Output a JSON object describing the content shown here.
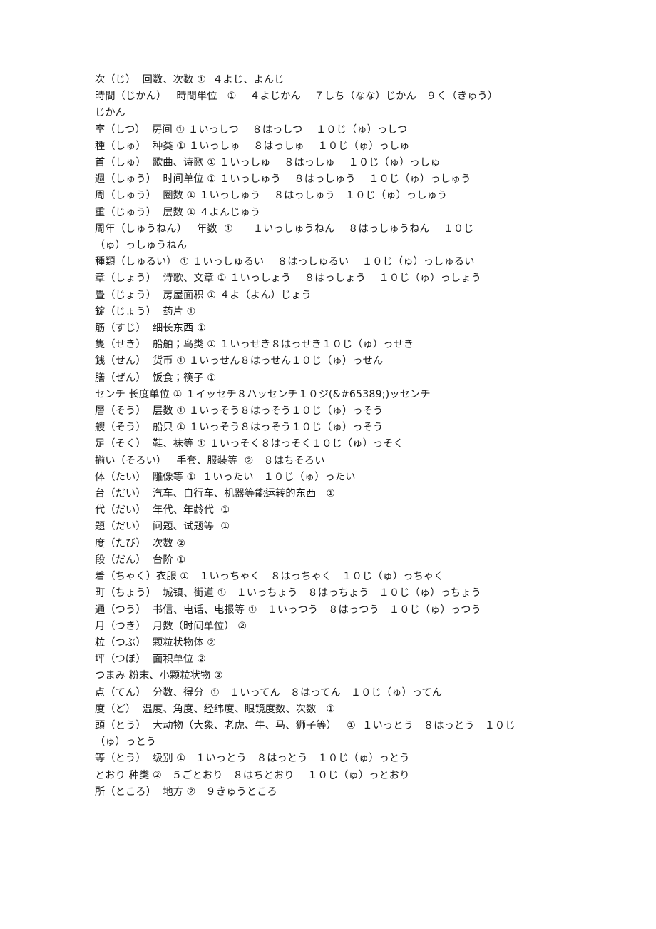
{
  "document": {
    "page_background": "#ffffff",
    "text_color": "#1b1b1b",
    "lines": [
      {
        "id": "line-ji",
        "text": "次（じ）  回数、次数 ①  ４よじ、よんじ"
      },
      {
        "id": "line-jikan",
        "text": "時間（じかん）   時間単位   ①    ４よじかん    ７しち（なな）じかん   ９く（きゅう）"
      },
      {
        "id": "line-jikan-cont",
        "text": "じかん"
      },
      {
        "id": "line-shitsu",
        "text": "室（しつ）  房间 ① １いっしつ    ８はっしつ    １０じ（ゅ）っしつ"
      },
      {
        "id": "line-shu-kind",
        "text": "種（しゅ）  种类 ① １いっしゅ    ８はっしゅ    １０じ（ゅ）っしゅ"
      },
      {
        "id": "line-shu-song",
        "text": "首（しゅ）  歌曲、诗歌 ① １いっしゅ    ８はっしゅ    １０じ（ゅ）っしゅ"
      },
      {
        "id": "line-shuu-week",
        "text": "週（しゅう）  时间单位 ① １いっしゅう    ８はっしゅう    １０じ（ゅ）っしゅう"
      },
      {
        "id": "line-shuu-lap",
        "text": "周（しゅう）  圈数 ① １いっしゅう    ８はっしゅう   １０じ（ゅ）っしゅう"
      },
      {
        "id": "line-juu-layer",
        "text": "重（じゅう）  层数 ① ４よんじゅう"
      },
      {
        "id": "line-shuunen",
        "text": "周年（しゅうねん）   年数  ①      １いっしゅうねん    ８はっしゅうねん    １０じ"
      },
      {
        "id": "line-shuunen-c",
        "text": "（ゅ）っしゅうねん"
      },
      {
        "id": "line-shurui",
        "text": "種類（しゅるい） ① １いっしゅるい    ８はっしゅるい    １０じ（ゅ）っしゅるい"
      },
      {
        "id": "line-shou",
        "text": "章（しょう）  诗歌、文章 ① １いっしょう    ８はっしょう    １０じ（ゅ）っしょう"
      },
      {
        "id": "line-jou-tatami",
        "text": "畳（じょう）  房屋面积 ① ４よ（よん）じょう"
      },
      {
        "id": "line-jou-pill",
        "text": "錠（じょう）  药片 ①"
      },
      {
        "id": "line-suji",
        "text": "筋（すじ）  细长东西 ①"
      },
      {
        "id": "line-seki",
        "text": "隻（せき）  船舶；鸟类 ① １いっせき８はっせき１０じ（ゅ）っせき"
      },
      {
        "id": "line-sen",
        "text": "銭（せん）  货币 ① １いっせん８はっせん１０じ（ゅ）っせん"
      },
      {
        "id": "line-zen",
        "text": "膳（ぜん）  饭食；筷子 ①"
      },
      {
        "id": "line-senchi",
        "text": "センチ 长度单位 ① １イッセチ８ハッセンチ１０ジ(&#65389;)ッセンチ"
      },
      {
        "id": "line-sou-layer",
        "text": "層（そう）  层数 ① １いっそう８はっそう１０じ（ゅ）っそう"
      },
      {
        "id": "line-sou-ship",
        "text": "艘（そう）  船只 ① １いっそう８はっそう１０じ（ゅ）っそう"
      },
      {
        "id": "line-soku",
        "text": "足（そく）  鞋、袜等 ① １いっそく８はっそく１０じ（ゅ）っそく"
      },
      {
        "id": "line-soroi",
        "text": "揃い（そろい）   手套、服装等  ②   ８はちそろい"
      },
      {
        "id": "line-tai",
        "text": "体（たい）  雕像等 ①  １いったい   １０じ（ゅ）ったい"
      },
      {
        "id": "line-dai-machine",
        "text": "台（だい）  汽车、自行车、机器等能运转的东西   ①"
      },
      {
        "id": "line-dai-era",
        "text": "代（だい）  年代、年龄代  ①"
      },
      {
        "id": "line-dai-topic",
        "text": "題（だい）  问题、试题等  ①"
      },
      {
        "id": "line-tabi",
        "text": "度（たび）  次数 ②"
      },
      {
        "id": "line-dan",
        "text": "段（だん）  台阶 ①"
      },
      {
        "id": "line-chaku",
        "text": "着（ちゃく）衣服 ①   １いっちゃく   ８はっちゃく   １０じ（ゅ）っちゃく"
      },
      {
        "id": "line-chou",
        "text": "町（ちょう）  城镇、街道 ①   １いっちょう   ８はっちょう   １０じ（ゅ）っちょう"
      },
      {
        "id": "line-tsuu",
        "text": "通（つう）  书信、电话、电报等 ①   １いっつう   ８はっつう   １０じ（ゅ）っつう"
      },
      {
        "id": "line-tsuki",
        "text": "月（つき）  月数（时间单位） ②"
      },
      {
        "id": "line-tsubu",
        "text": "粒（つぶ）  颗粒状物体 ②"
      },
      {
        "id": "line-tsubo",
        "text": "坪（つぼ）  面积单位 ②"
      },
      {
        "id": "line-tsumami",
        "text": "つまみ 粉末、小颗粒状物 ②"
      },
      {
        "id": "line-ten",
        "text": "点（てん）  分数、得分  ①   １いってん   ８はってん   １０じ（ゅ）ってん"
      },
      {
        "id": "line-do",
        "text": "度（ど）  温度、角度、经纬度、眼镜度数、次数   ①"
      },
      {
        "id": "line-tou-animal",
        "text": "頭（とう）  大动物（大象、老虎、牛、马、狮子等）   ①  １いっとう   ８はっとう   １０じ"
      },
      {
        "id": "line-tou-cont",
        "text": "（ゅ）っとう"
      },
      {
        "id": "line-tou-rank",
        "text": "等（とう）  级别 ①   １いっとう   ８はっとう   １０じ（ゅ）っとう"
      },
      {
        "id": "line-toori",
        "text": "とおり 种类 ②   ５ごとおり   ８はちとおり    １０じ（ゅ）っとおり"
      },
      {
        "id": "line-tokoro",
        "text": "所（ところ）  地方 ②   ９きゅうところ"
      }
    ]
  }
}
